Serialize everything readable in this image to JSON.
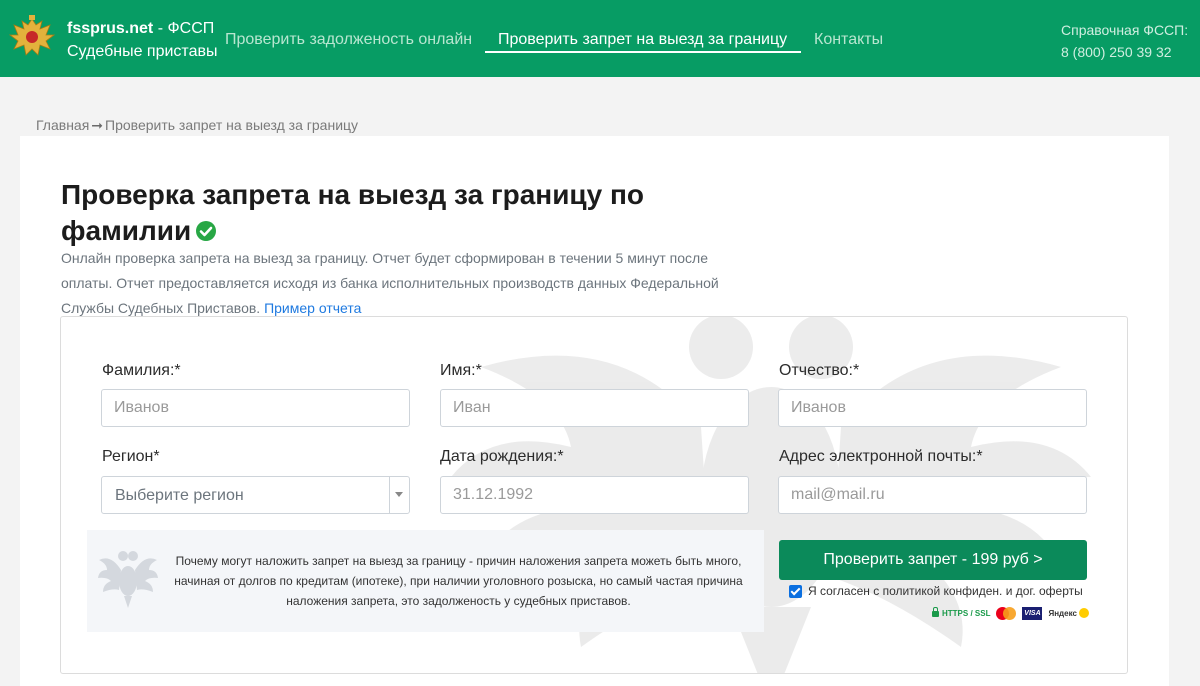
{
  "header": {
    "brand_site": "fssprus.net",
    "brand_suffix": " - ФССП",
    "brand_subtitle": "Судебные приставы",
    "nav": [
      {
        "label": "Проверить задолженость онлайн",
        "active": false
      },
      {
        "label": "Проверить запрет на выезд за границу",
        "active": true
      },
      {
        "label": "Контакты",
        "active": false
      }
    ],
    "help_title": "Справочная ФССП:",
    "help_phone": "8 (800) 250 39 32"
  },
  "breadcrumb": {
    "home": "Главная",
    "current": "Проверить запрет на выезд за границу"
  },
  "main": {
    "title": "Проверка запрета на выезд за границу по фамилии",
    "description": "Онлайн проверка запрета на выезд за границу. Отчет будет сформирован в течении 5 минут после оплаты. Отчет предоставляется исходя из банка исполнительных производств данных Федеральной Службы Судебных Приставов.",
    "sample_link": "Пример отчета"
  },
  "form": {
    "surname": {
      "label": "Фамилия:*",
      "placeholder": "Иванов"
    },
    "name": {
      "label": "Имя:*",
      "placeholder": "Иван"
    },
    "patronymic": {
      "label": "Отчество:*",
      "placeholder": "Иванов"
    },
    "region": {
      "label": "Регион*",
      "selected": "Выберите регион"
    },
    "birthdate": {
      "label": "Дата рождения:*",
      "placeholder": "31.12.1992"
    },
    "email": {
      "label": "Адрес электронной почты:*",
      "placeholder": "mail@mail.ru"
    },
    "info_text": "Почему могут наложить запрет на выезд за границу - причин наложения запрета можеть быть много, начиная от долгов по кредитам (ипотеке), при наличии уголовного розыска, но самый частая причина наложения запрета, это задолженость у судебных приставов.",
    "submit_label": "Проверить запрет - 199 руб >",
    "agree_label": "Я согласен с политикой конфиден. и дог. оферты",
    "agree_checked": true,
    "badge_https": "HTTPS / SSL",
    "badge_visa": "VISA",
    "badge_yandex": "Яндекс"
  },
  "colors": {
    "header_bg": "#079c64",
    "button_bg": "#0b8a5a",
    "link": "#1f7ae0",
    "check": "#28a745"
  }
}
